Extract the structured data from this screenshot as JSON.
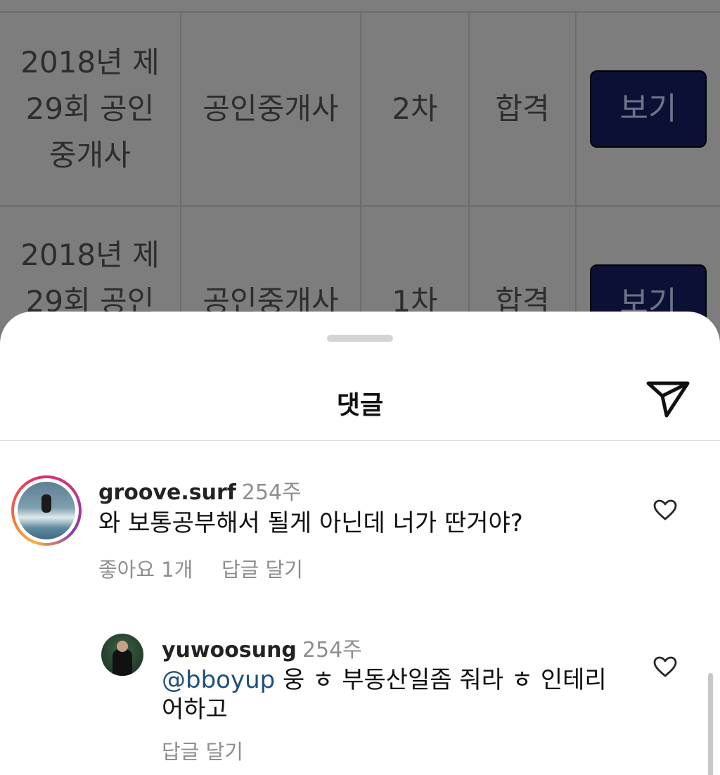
{
  "background_table": {
    "rows": [
      {
        "exam": "2018년 제 29회 공인 중개사",
        "field": "공인중개사",
        "round": "2차",
        "result": "합격",
        "button": "보기"
      },
      {
        "exam": "2018년 제 29회 공인",
        "field": "공인중개사",
        "round": "1차",
        "result": "합격",
        "button": "보기"
      }
    ]
  },
  "sheet": {
    "title": "댓글",
    "share_icon": "paper-plane-icon"
  },
  "comments": [
    {
      "username": "groove.surf",
      "time": "254주",
      "text": "와 보통공부해서 될게 아닌데 너가 딴거야?",
      "likes": "좋아요 1개",
      "reply": "답글 달기",
      "avatar_icon": "surfer-avatar",
      "heart_icon": "heart-outline-icon"
    },
    {
      "username": "yuwoosung",
      "time": "254주",
      "mention": "@bboyup",
      "text": " 웅 ㅎ 부동산일좀 줘라 ㅎ 인테리어하고",
      "reply": "답글 달기",
      "avatar_icon": "suit-avatar",
      "heart_icon": "heart-outline-icon"
    }
  ],
  "colors": {
    "mention": "#1e4f7d",
    "muted": "#8e8e8e",
    "dim_overlay": "#7d7d7d",
    "button_navy": "#0c1034"
  }
}
